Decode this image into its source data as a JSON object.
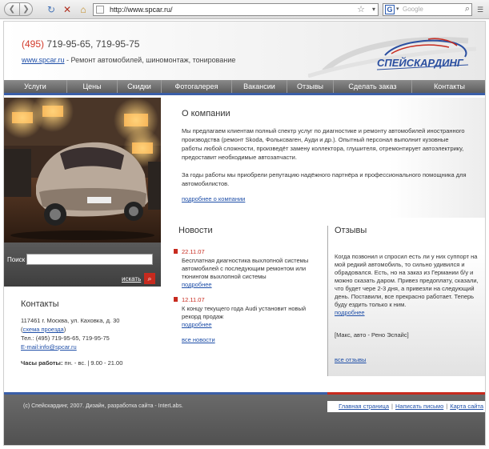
{
  "browser": {
    "url": "http://www.spcar.ru/",
    "search_placeholder": "Google"
  },
  "header": {
    "phone_code": "(495)",
    "phone_numbers": " 719-95-65, 719-95-75",
    "site_link": "www.spcar.ru",
    "tagline": " - Ремонт автомобилей, шиномонтаж, тонирование",
    "logo_text": "СПЕЙСКАРДИНГ"
  },
  "menu": {
    "items": [
      "Услуги",
      "Цены",
      "Скидки",
      "Фотогалерея",
      "Вакансии",
      "Отзывы",
      "Сделать заказ",
      "Контакты"
    ]
  },
  "search": {
    "label": "Поиск",
    "value": "",
    "button_label": "искать"
  },
  "contacts": {
    "title": "Контакты",
    "address": "117461 г. Москва, ул. Каховка, д. 30",
    "map_link": "схема проезда",
    "tel": "Тел.: (495) 719-95-65, 719-95-75",
    "email": "E-mail:info@spcar.ru",
    "hours_label": "Часы работы:",
    "hours_value": " пн. - вс. | 9.00 - 21.00"
  },
  "about": {
    "title": "О компании",
    "p1": "Мы предлагаем клиентам полный спектр услуг по диагностике и ремонту автомобилей иностранного производства (ремонт Skoda, Фольксваген, Ауди и др.). Опытный персонал выполнит кузовные работы любой сложности, произведёт замену коллектора, глушителя, отремонтирует автоэлектрику, предоставит необходимые автозапчасти.",
    "p2": "За годы работы мы приобрели репутацию надёжного партнёра и профессионального помощника для автомобилистов.",
    "more_link": "подробнее о компании"
  },
  "news": {
    "title": "Новости",
    "items": [
      {
        "date": "22.11.07",
        "text": "Бесплатная диагностика выхлопной системы автомобилей с последующим ремонтом или тюнингом выхлопной системы",
        "more": "подробнее"
      },
      {
        "date": "12.11.07",
        "text": "К концу текущего года Audi установит новый рекорд продаж",
        "more": "подробнее"
      }
    ],
    "all_link": "все новости"
  },
  "reviews": {
    "title": "Отзывы",
    "text": "Когда позвонил и спросил есть ли у них суппорт на мой редкий автомобиль, то сильно удивился и обрадовался. Есть, но на заказ из Германии б/у и можно сказать даром. Привез предоплату, сказали, что будет чере 2-3 дня, а привезли на следующий день. Поставили, все прекрасно работает. Теперь буду ездить только к ним.",
    "more": "подробнее",
    "signature": "[Макс,  авто - Рено Эспайс]",
    "all_link": "все отзывы"
  },
  "footer": {
    "copyright": "(c) Спейскардинг, 2007.  Дизайн, разработка сайта - InterLabs.",
    "links": [
      "Главная страница",
      "Написать письмо",
      "Карта сайта"
    ]
  },
  "colors": {
    "accent_red": "#c72a1e",
    "accent_blue": "#3a5ea8",
    "link": "#1f4fa8",
    "menu_bg": "#6c6c6c"
  }
}
